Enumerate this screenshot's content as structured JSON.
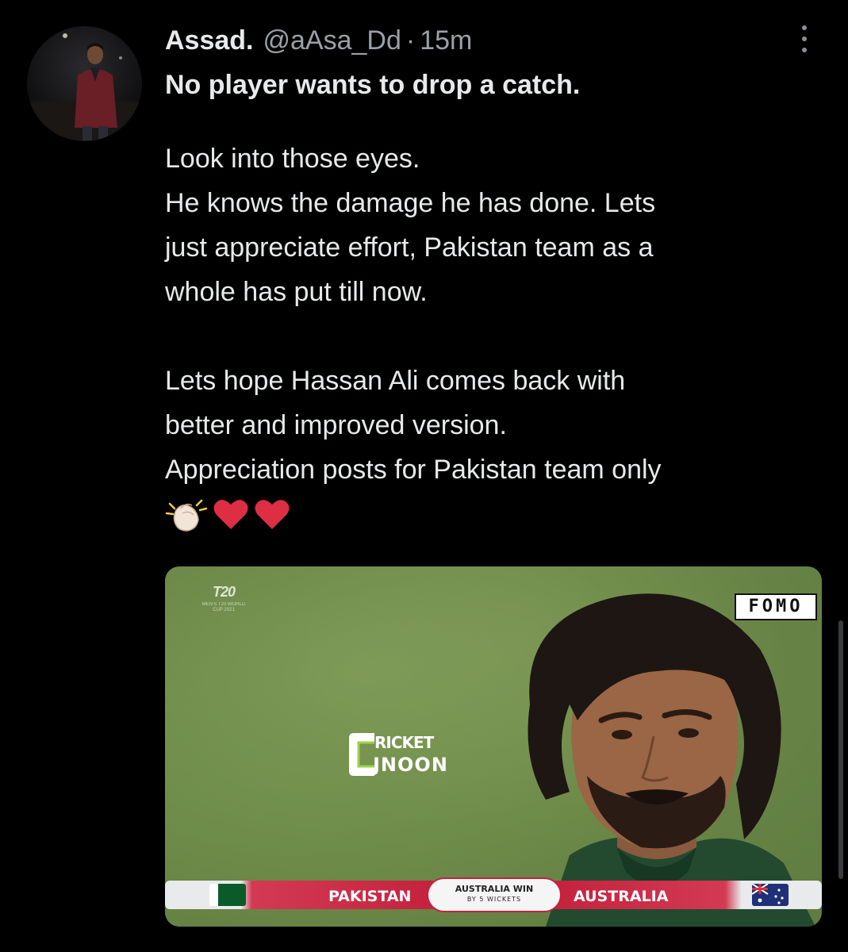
{
  "tweet": {
    "display_name": "Assad.",
    "handle": "@aAsa_Dd",
    "separator": "·",
    "time": "15m",
    "first_line": "No player wants to drop a catch.",
    "paragraph1": [
      "Look into those eyes.",
      "He knows the damage he has done. Lets",
      "just appreciate effort, Pakistan team as a",
      "whole has put till now."
    ],
    "paragraph2": [
      "Lets hope Hassan Ali comes back with",
      "better and improved version.",
      "Appreciation posts for Pakistan team only"
    ],
    "emojis": [
      "clapping-hands",
      "red-heart",
      "red-heart"
    ]
  },
  "media": {
    "watermark_fomo": "FOMO",
    "t20_logo_text": "T20",
    "t20_logo_sub": "MEN'S T20 WORLD CUP 2021",
    "brand_top": "RICKET",
    "brand_bottom": "JNOON",
    "scorebar": {
      "team_left": "PAKISTAN",
      "team_right": "AUSTRALIA",
      "result_line1": "AUSTRALIA WIN",
      "result_line2": "BY 5 WICKETS"
    }
  },
  "colors": {
    "background": "#000000",
    "text": "#e7e9ea",
    "muted": "#9aa0a6",
    "scorebar_red": "#c4223f",
    "pitch_green": "#6b8848"
  }
}
